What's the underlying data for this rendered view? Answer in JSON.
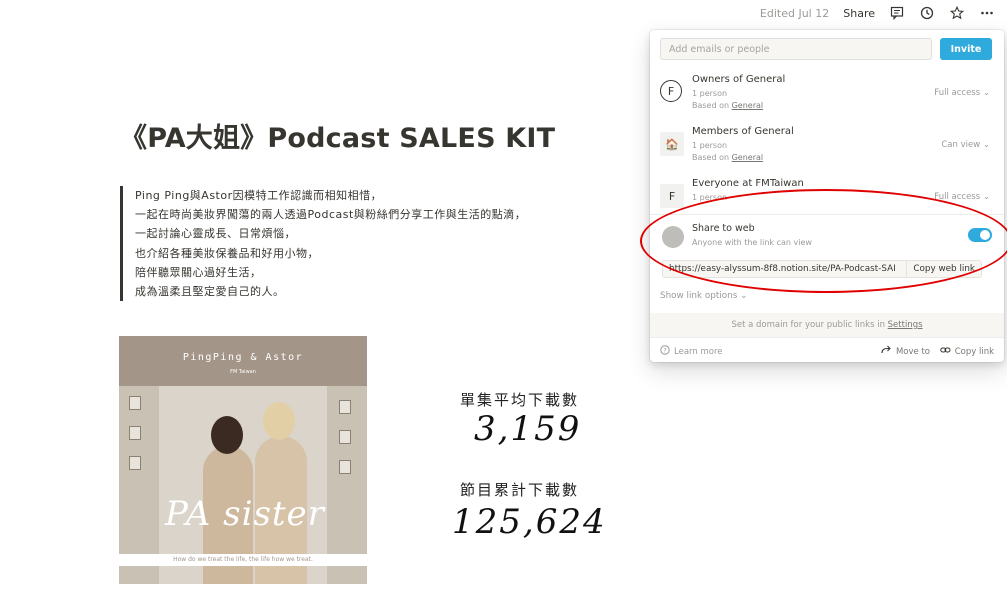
{
  "topbar": {
    "edited": "Edited Jul 12",
    "share": "Share",
    "icons": [
      "comment-icon",
      "history-icon",
      "star-icon",
      "more-icon"
    ]
  },
  "page": {
    "title": "《PA大姐》Podcast SALES KIT",
    "quote_lines": [
      "Ping Ping與Astor因模特工作認識而相知相惜，",
      "一起在時尚美妝界闖蕩的兩人透過Podcast與粉絲們分享工作與生活的點滴，",
      "一起討論心靈成長、日常煩惱，",
      "也介紹各種美妝保養品和好用小物，",
      "陪伴聽眾關心過好生活，",
      "成為溫柔且堅定愛自己的人。"
    ],
    "cover": {
      "title": "PingPing & Astor",
      "logo": "FM Taiwan",
      "script": "PA sister",
      "tagline": "How do we treat the life, the life how we treat."
    },
    "stats": [
      {
        "label": "單集平均下載數",
        "value": "3,159"
      },
      {
        "label": "節目累計下載數",
        "value": "125,624"
      }
    ]
  },
  "share_panel": {
    "input_placeholder": "Add emails or people",
    "invite_label": "Invite",
    "members": [
      {
        "avatar": "F",
        "name": "Owners of General",
        "count": "1 person",
        "based_prefix": "Based on ",
        "based_link": "General",
        "permission": "Full access"
      },
      {
        "avatar": "🏠",
        "name": "Members of General",
        "count": "1 person",
        "based_prefix": "Based on ",
        "based_link": "General",
        "permission": "Can view"
      },
      {
        "avatar": "F",
        "name": "Everyone at FMTaiwan",
        "count": "1 person",
        "based_prefix": "",
        "based_link": "",
        "permission": "Full access"
      }
    ],
    "share_to_web": {
      "title": "Share to web",
      "subtitle": "Anyone with the link can view",
      "enabled": true
    },
    "link_url": "https://easy-alyssum-8f8.notion.site/PA-Podcast-SAI",
    "copy_web_link": "Copy web link",
    "show_link_options": "Show link options",
    "domain_prefix": "Set a domain for your public links in ",
    "domain_link": "Settings",
    "learn_more": "Learn more",
    "move_to": "Move to",
    "copy_link": "Copy link"
  },
  "colors": {
    "accent": "#2eaadc",
    "annotation": "#e00000",
    "cover_bg": "#a39588"
  }
}
